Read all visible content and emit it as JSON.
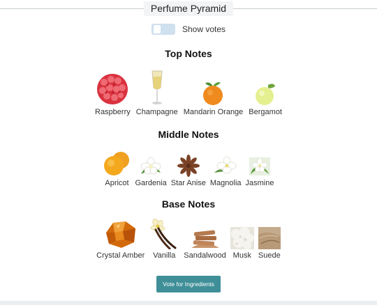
{
  "title": "Perfume Pyramid",
  "toggle": {
    "label": "Show votes",
    "on": false
  },
  "sections": {
    "top": {
      "title": "Top Notes",
      "notes": [
        {
          "label": "Raspberry",
          "icon": "raspberry-icon"
        },
        {
          "label": "Champagne",
          "icon": "champagne-icon"
        },
        {
          "label": "Mandarin Orange",
          "icon": "mandarin-orange-icon"
        },
        {
          "label": "Bergamot",
          "icon": "bergamot-icon"
        }
      ]
    },
    "middle": {
      "title": "Middle Notes",
      "notes": [
        {
          "label": "Apricot",
          "icon": "apricot-icon"
        },
        {
          "label": "Gardenia",
          "icon": "gardenia-icon"
        },
        {
          "label": "Star Anise",
          "icon": "star-anise-icon"
        },
        {
          "label": "Magnolia",
          "icon": "magnolia-icon"
        },
        {
          "label": "Jasmine",
          "icon": "jasmine-icon"
        }
      ]
    },
    "base": {
      "title": "Base Notes",
      "notes": [
        {
          "label": "Crystal Amber",
          "icon": "crystal-amber-icon"
        },
        {
          "label": "Vanilla",
          "icon": "vanilla-icon"
        },
        {
          "label": "Sandalwood",
          "icon": "sandalwood-icon"
        },
        {
          "label": "Musk",
          "icon": "musk-icon"
        },
        {
          "label": "Suede",
          "icon": "suede-icon"
        }
      ]
    }
  },
  "vote_button": {
    "label": "Vote for Ingredients"
  },
  "colors": {
    "accent": "#3f8f98",
    "toggle_bg": "#cfe0ee",
    "title_bg": "#f3f4f6"
  }
}
